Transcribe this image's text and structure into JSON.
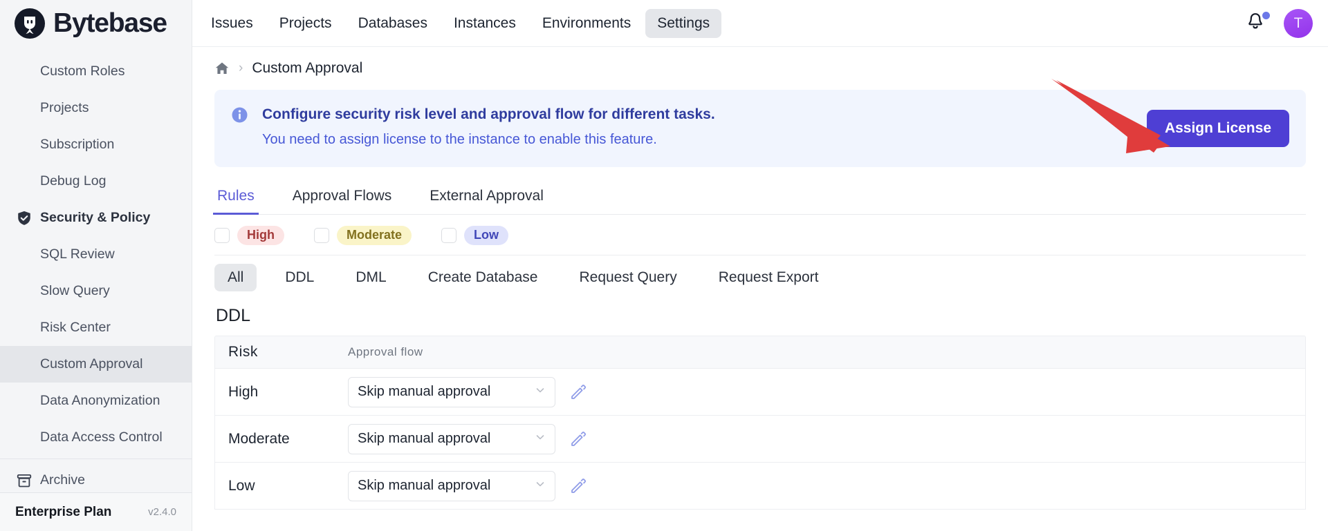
{
  "brand": {
    "name": "Bytebase",
    "logo_icon": "bytebase-logo-icon"
  },
  "topnav": {
    "items": [
      {
        "label": "Issues",
        "active": false
      },
      {
        "label": "Projects",
        "active": false
      },
      {
        "label": "Databases",
        "active": false
      },
      {
        "label": "Instances",
        "active": false
      },
      {
        "label": "Environments",
        "active": false
      },
      {
        "label": "Settings",
        "active": true
      }
    ],
    "bell_icon": "bell-icon",
    "notification_dot_color": "#6c78e8",
    "avatar_initial": "T",
    "avatar_color": "#9333ea"
  },
  "sidebar": {
    "items": [
      {
        "label": "Custom Roles",
        "icon": "",
        "indented": true,
        "section": false,
        "active": false
      },
      {
        "label": "Projects",
        "icon": "",
        "indented": true,
        "section": false,
        "active": false
      },
      {
        "label": "Subscription",
        "icon": "",
        "indented": true,
        "section": false,
        "active": false
      },
      {
        "label": "Debug Log",
        "icon": "",
        "indented": true,
        "section": false,
        "active": false
      },
      {
        "label": "Security & Policy",
        "icon": "shield-check-icon",
        "indented": false,
        "section": true,
        "active": false
      },
      {
        "label": "SQL Review",
        "icon": "",
        "indented": true,
        "section": false,
        "active": false
      },
      {
        "label": "Slow Query",
        "icon": "",
        "indented": true,
        "section": false,
        "active": false
      },
      {
        "label": "Risk Center",
        "icon": "",
        "indented": true,
        "section": false,
        "active": false
      },
      {
        "label": "Custom Approval",
        "icon": "",
        "indented": true,
        "section": false,
        "active": true
      },
      {
        "label": "Data Anonymization",
        "icon": "",
        "indented": true,
        "section": false,
        "active": false
      },
      {
        "label": "Data Access Control",
        "icon": "",
        "indented": true,
        "section": false,
        "active": false
      },
      {
        "label": "Archive",
        "icon": "archive-icon",
        "indented": false,
        "section": false,
        "active": false
      }
    ],
    "footer": {
      "plan": "Enterprise Plan",
      "version": "v2.4.0"
    }
  },
  "breadcrumb": {
    "home_icon": "home-icon",
    "separator": "›",
    "current": "Custom Approval"
  },
  "banner": {
    "icon": "info-circle-icon",
    "line1": "Configure security risk level and approval flow for different tasks.",
    "line2": "You need to assign license to the instance to enable this feature.",
    "background": "#f1f5fe",
    "button_label": "Assign License",
    "button_color": "#4e3fd4"
  },
  "annotation": {
    "arrow_color": "#e03c3c",
    "points_to": "Assign License"
  },
  "tabs": [
    {
      "label": "Rules",
      "active": true
    },
    {
      "label": "Approval Flows",
      "active": false
    },
    {
      "label": "External Approval",
      "active": false
    }
  ],
  "risk_filters": [
    {
      "label": "High",
      "checked": false,
      "bg": "#fce4e4",
      "fg": "#a33a3a"
    },
    {
      "label": "Moderate",
      "checked": false,
      "bg": "#faf4c8",
      "fg": "#82711f"
    },
    {
      "label": "Low",
      "checked": false,
      "bg": "#dfe2fb",
      "fg": "#4147b8"
    }
  ],
  "type_filters": [
    {
      "label": "All",
      "active": true
    },
    {
      "label": "DDL",
      "active": false
    },
    {
      "label": "DML",
      "active": false
    },
    {
      "label": "Create Database",
      "active": false
    },
    {
      "label": "Request Query",
      "active": false
    },
    {
      "label": "Request Export",
      "active": false
    }
  ],
  "section": {
    "title": "DDL",
    "columns": [
      "Risk",
      "Approval flow"
    ],
    "rows": [
      {
        "risk": "High",
        "flow": "Skip manual approval",
        "edit_icon": "edit-pencil-icon"
      },
      {
        "risk": "Moderate",
        "flow": "Skip manual approval",
        "edit_icon": "edit-pencil-icon"
      },
      {
        "risk": "Low",
        "flow": "Skip manual approval",
        "edit_icon": "edit-pencil-icon"
      }
    ]
  }
}
